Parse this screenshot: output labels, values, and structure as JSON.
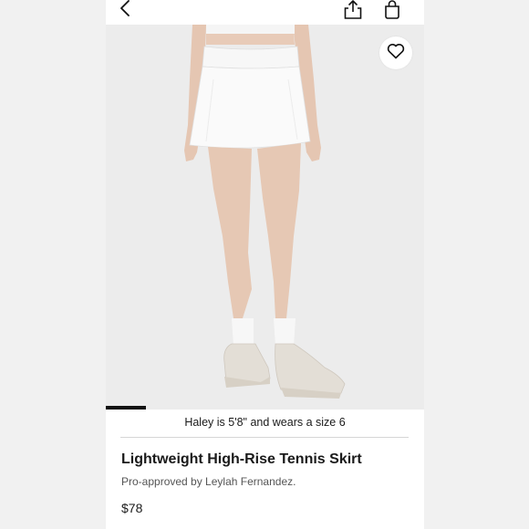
{
  "header": {
    "back_icon": "chevron-left-icon",
    "share_icon": "share-icon",
    "bag_icon": "shopping-bag-icon"
  },
  "product": {
    "favorite_icon": "heart-icon",
    "image_progress": 0.125,
    "model_caption": "Haley is 5'8\" and wears a size 6",
    "name": "Lightweight High-Rise Tennis Skirt",
    "tagline": "Pro-approved by Leylah Fernandez.",
    "price": "$78"
  },
  "colors": {
    "background_side": "#f1f1f1",
    "photo_background": "#ececec",
    "text_primary": "#1a1a1a",
    "text_secondary": "#555555"
  }
}
